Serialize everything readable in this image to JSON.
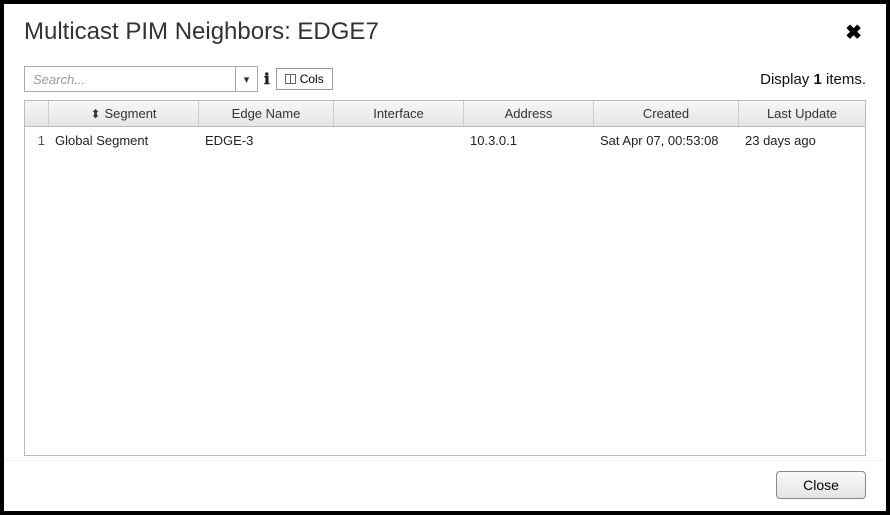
{
  "dialog": {
    "title": "Multicast PIM Neighbors: EDGE7",
    "close_label": "Close"
  },
  "toolbar": {
    "search_placeholder": "Search...",
    "cols_label": "Cols",
    "display_prefix": "Display ",
    "display_count": "1",
    "display_suffix": " items."
  },
  "table": {
    "columns": {
      "segment": "Segment",
      "edge_name": "Edge Name",
      "interface": "Interface",
      "address": "Address",
      "created": "Created",
      "last_update": "Last Update"
    },
    "rows": [
      {
        "index": "1",
        "segment": "Global Segment",
        "edge_name": "EDGE-3",
        "interface": "",
        "address": "10.3.0.1",
        "created": "Sat Apr 07, 00:53:08",
        "last_update": "23 days ago"
      }
    ]
  }
}
